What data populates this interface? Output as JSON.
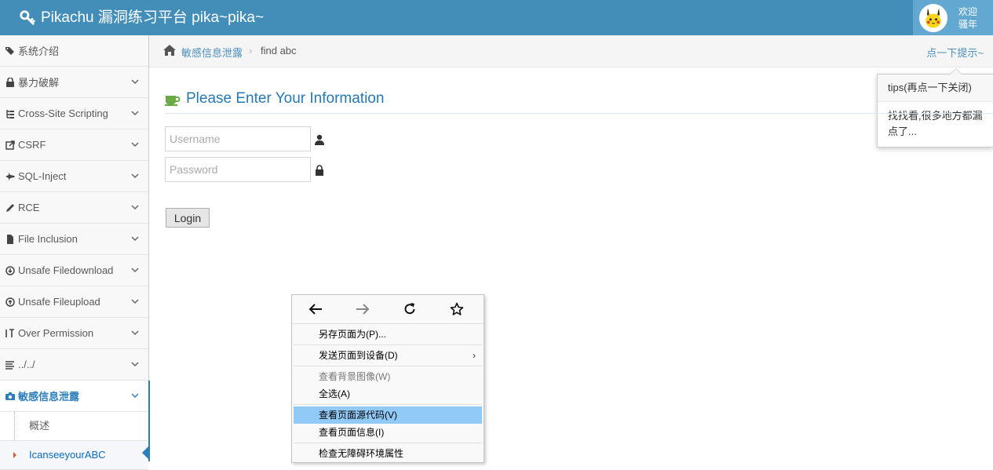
{
  "app": {
    "brand_title": "Pikachu 漏洞练习平台 pika~pika~",
    "welcome_line1": "欢迎",
    "welcome_line2": "骚年"
  },
  "sidebar": {
    "items": [
      {
        "label": "系统介绍",
        "icon": "tags-icon"
      },
      {
        "label": "暴力破解",
        "icon": "lock-icon"
      },
      {
        "label": "Cross-Site Scripting",
        "icon": "sitemap-icon"
      },
      {
        "label": "CSRF",
        "icon": "external-link-icon"
      },
      {
        "label": "SQL-Inject",
        "icon": "fighter-jet-icon"
      },
      {
        "label": "RCE",
        "icon": "pencil-icon"
      },
      {
        "label": "File Inclusion",
        "icon": "file-icon"
      },
      {
        "label": "Unsafe Filedownload",
        "icon": "download-icon"
      },
      {
        "label": "Unsafe Fileupload",
        "icon": "upload-icon"
      },
      {
        "label": "Over Permission",
        "icon": "text-height-icon"
      },
      {
        "label": "../../",
        "icon": "list-icon"
      },
      {
        "label": "敏感信息泄露",
        "icon": "camera-icon"
      }
    ],
    "sub_items": [
      {
        "label": "概述"
      },
      {
        "label": "IcanseeyourABC"
      }
    ]
  },
  "breadcrumb": {
    "home_link": "敏感信息泄露",
    "separator": "›",
    "current": "find abc",
    "hint_link": "点一下提示~"
  },
  "popover": {
    "title": "tips(再点一下关闭)",
    "content": "找找看,很多地方都漏点了..."
  },
  "form": {
    "title": "Please Enter Your Information",
    "username_placeholder": "Username",
    "password_placeholder": "Password",
    "login_label": "Login"
  },
  "context_menu": {
    "items": [
      {
        "label": "另存页面为(P)...",
        "state": "normal"
      },
      {
        "label": "发送页面到设备(D)",
        "state": "normal",
        "submenu_arrow": "›"
      },
      {
        "label": "查看背景图像(W)",
        "state": "disabled"
      },
      {
        "label": "全选(A)",
        "state": "normal"
      },
      {
        "label": "查看页面源代码(V)",
        "state": "highlighted"
      },
      {
        "label": "查看页面信息(I)",
        "state": "normal"
      },
      {
        "label": "检查无障碍环境属性",
        "state": "normal"
      }
    ]
  },
  "colors": {
    "navbar": "#438eb9",
    "accent": "#2b7dbc",
    "highlight": "#91c9f7"
  }
}
